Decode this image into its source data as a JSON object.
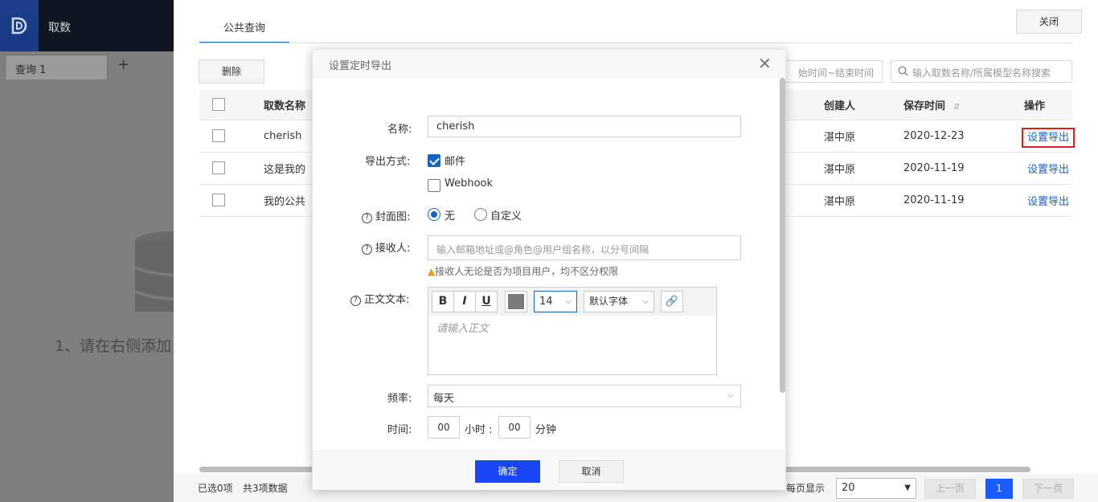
{
  "app": {
    "title": "取数",
    "query_tab": "查询 1",
    "add_tab": "+",
    "empty_hint": "1、请在右侧添加"
  },
  "panel": {
    "tab_label": "公共查询",
    "close_label": "关闭",
    "delete_label": "删除",
    "date_range_placeholder": "始时间~结束时间",
    "search_placeholder": "输入取数名称/所属模型名称搜索",
    "columns": {
      "name": "取数名称",
      "creator": "创建人",
      "saved_time": "保存时间",
      "action": "操作"
    },
    "rows": [
      {
        "name": "cherish",
        "creator": "湛中原",
        "saved_time": "2020-12-23",
        "action": "设置导出"
      },
      {
        "name": "这是我的",
        "creator": "湛中原",
        "saved_time": "2020-11-19",
        "action": "设置导出"
      },
      {
        "name": "我的公共",
        "creator": "湛中原",
        "saved_time": "2020-11-19",
        "action": "设置导出"
      }
    ],
    "footer": {
      "selected": "已选0项",
      "total": "共3项数据",
      "per_page_label": "每页显示",
      "per_page": "20",
      "prev": "上一页",
      "page": "1",
      "next": "下一页"
    }
  },
  "modal": {
    "title": "设置定时导出",
    "name_label": "名称:",
    "name_value": "cherish",
    "export_label": "导出方式:",
    "export_options": [
      "邮件",
      "Webhook"
    ],
    "export_checked": [
      true,
      false
    ],
    "cover_label": "封面图:",
    "cover_options": [
      "无",
      "自定义"
    ],
    "cover_selected": "无",
    "recipient_label": "接收人:",
    "recipient_placeholder": "输入邮箱地址或@角色@用户组名称，以分号间隔",
    "recipient_warning": "接收人无论是否为项目用户，均不区分权限",
    "body_label": "正文文本:",
    "font_size": "14",
    "font_family": "默认字体",
    "body_placeholder": "请输入正文",
    "freq_label": "频率:",
    "freq_value": "每天",
    "time_label": "时间:",
    "hour": "00",
    "hour_unit": "小时 :",
    "minute": "00",
    "minute_unit": "分钟",
    "ok_label": "确定",
    "cancel_label": "取消"
  },
  "colors": {
    "primary": "#1a46f5",
    "link": "#1565c0",
    "highlight_border": "#e02020"
  }
}
